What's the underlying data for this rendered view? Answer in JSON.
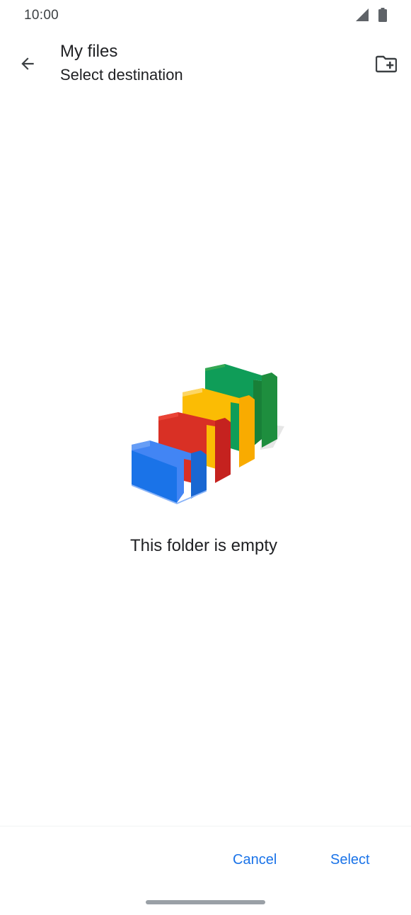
{
  "status_bar": {
    "time": "10:00",
    "icons": [
      "cell-signal-icon",
      "battery-icon"
    ]
  },
  "app_bar": {
    "back_icon": "arrow-back-icon",
    "title": "My files",
    "subtitle": "Select destination",
    "new_folder_icon": "create-new-folder-icon"
  },
  "content": {
    "illustration": "empty-folders-illustration",
    "empty_message": "This folder is empty"
  },
  "actions": {
    "cancel_label": "Cancel",
    "select_label": "Select"
  },
  "colors": {
    "accent": "#1a73e8",
    "text": "#202124",
    "folder_blue": "#4285f4",
    "folder_red": "#ea4335",
    "folder_yellow": "#fbbc04",
    "folder_green": "#34a853"
  }
}
